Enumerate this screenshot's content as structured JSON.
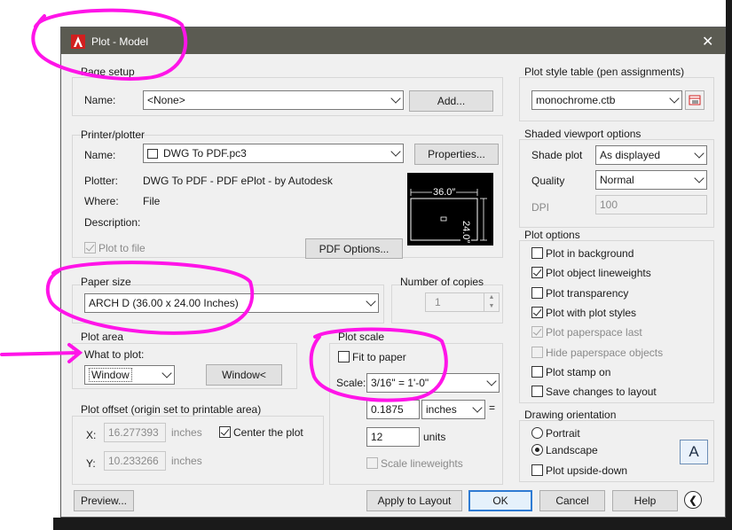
{
  "window": {
    "title": "Plot - Model",
    "close_glyph": "✕"
  },
  "page_setup": {
    "group": "Page setup",
    "name_label": "Name:",
    "name_value": "<None>",
    "add_button": "Add..."
  },
  "printer": {
    "group": "Printer/plotter",
    "name_label": "Name:",
    "name_value": "DWG To PDF.pc3",
    "properties_button": "Properties...",
    "plotter_label": "Plotter:",
    "plotter_value": "DWG To PDF - PDF ePlot - by Autodesk",
    "where_label": "Where:",
    "where_value": "File",
    "description_label": "Description:",
    "plot_to_file": "Plot to file",
    "plot_to_file_checked": true,
    "pdf_options_button": "PDF Options...",
    "preview_width": "36.0″",
    "preview_height": "24.0″"
  },
  "paper_size": {
    "group": "Paper size",
    "value": "ARCH D (36.00 x 24.00 Inches)"
  },
  "copies": {
    "group": "Number of copies",
    "value": "1"
  },
  "plot_area": {
    "group": "Plot area",
    "what_label": "What to plot:",
    "what_value": "Window",
    "window_button": "Window<"
  },
  "plot_offset": {
    "group": "Plot offset (origin set to printable area)",
    "x_label": "X:",
    "x_value": "16.277393",
    "x_unit": "inches",
    "y_label": "Y:",
    "y_value": "10.233266",
    "y_unit": "inches",
    "center_label": "Center the plot",
    "center_checked": true
  },
  "plot_scale": {
    "group": "Plot scale",
    "fit_label": "Fit to paper",
    "fit_checked": false,
    "scale_label": "Scale:",
    "scale_value": "3/16\" = 1'-0\"",
    "value1": "0.1875",
    "unit1": "inches",
    "equals": "=",
    "value2": "12",
    "unit2": "units",
    "lineweights_label": "Scale lineweights"
  },
  "plot_style": {
    "group": "Plot style table (pen assignments)",
    "value": "monochrome.ctb"
  },
  "shaded": {
    "group": "Shaded viewport options",
    "shade_label": "Shade plot",
    "shade_value": "As displayed",
    "quality_label": "Quality",
    "quality_value": "Normal",
    "dpi_label": "DPI",
    "dpi_value": "100"
  },
  "plot_options": {
    "group": "Plot options",
    "items": [
      {
        "label": "Plot in background",
        "checked": false,
        "disabled": false
      },
      {
        "label": "Plot object lineweights",
        "checked": true,
        "disabled": false
      },
      {
        "label": "Plot transparency",
        "checked": false,
        "disabled": false
      },
      {
        "label": "Plot with plot styles",
        "checked": true,
        "disabled": false
      },
      {
        "label": "Plot paperspace last",
        "checked": true,
        "disabled": true
      },
      {
        "label": "Hide paperspace objects",
        "checked": false,
        "disabled": true
      },
      {
        "label": "Plot stamp on",
        "checked": false,
        "disabled": false
      },
      {
        "label": "Save changes to layout",
        "checked": false,
        "disabled": false
      }
    ]
  },
  "orientation": {
    "group": "Drawing orientation",
    "portrait": "Portrait",
    "landscape": "Landscape",
    "selected": "Landscape",
    "upside_down": "Plot upside-down",
    "upside_down_checked": false,
    "icon_letter": "A"
  },
  "footer": {
    "preview": "Preview...",
    "apply": "Apply to Layout",
    "ok": "OK",
    "cancel": "Cancel",
    "help": "Help"
  },
  "colors": {
    "titlebar": "#5b5b52",
    "accent": "#2f7bd3",
    "annotation": "#ff14e8",
    "app_icon": "#d11f1f"
  }
}
